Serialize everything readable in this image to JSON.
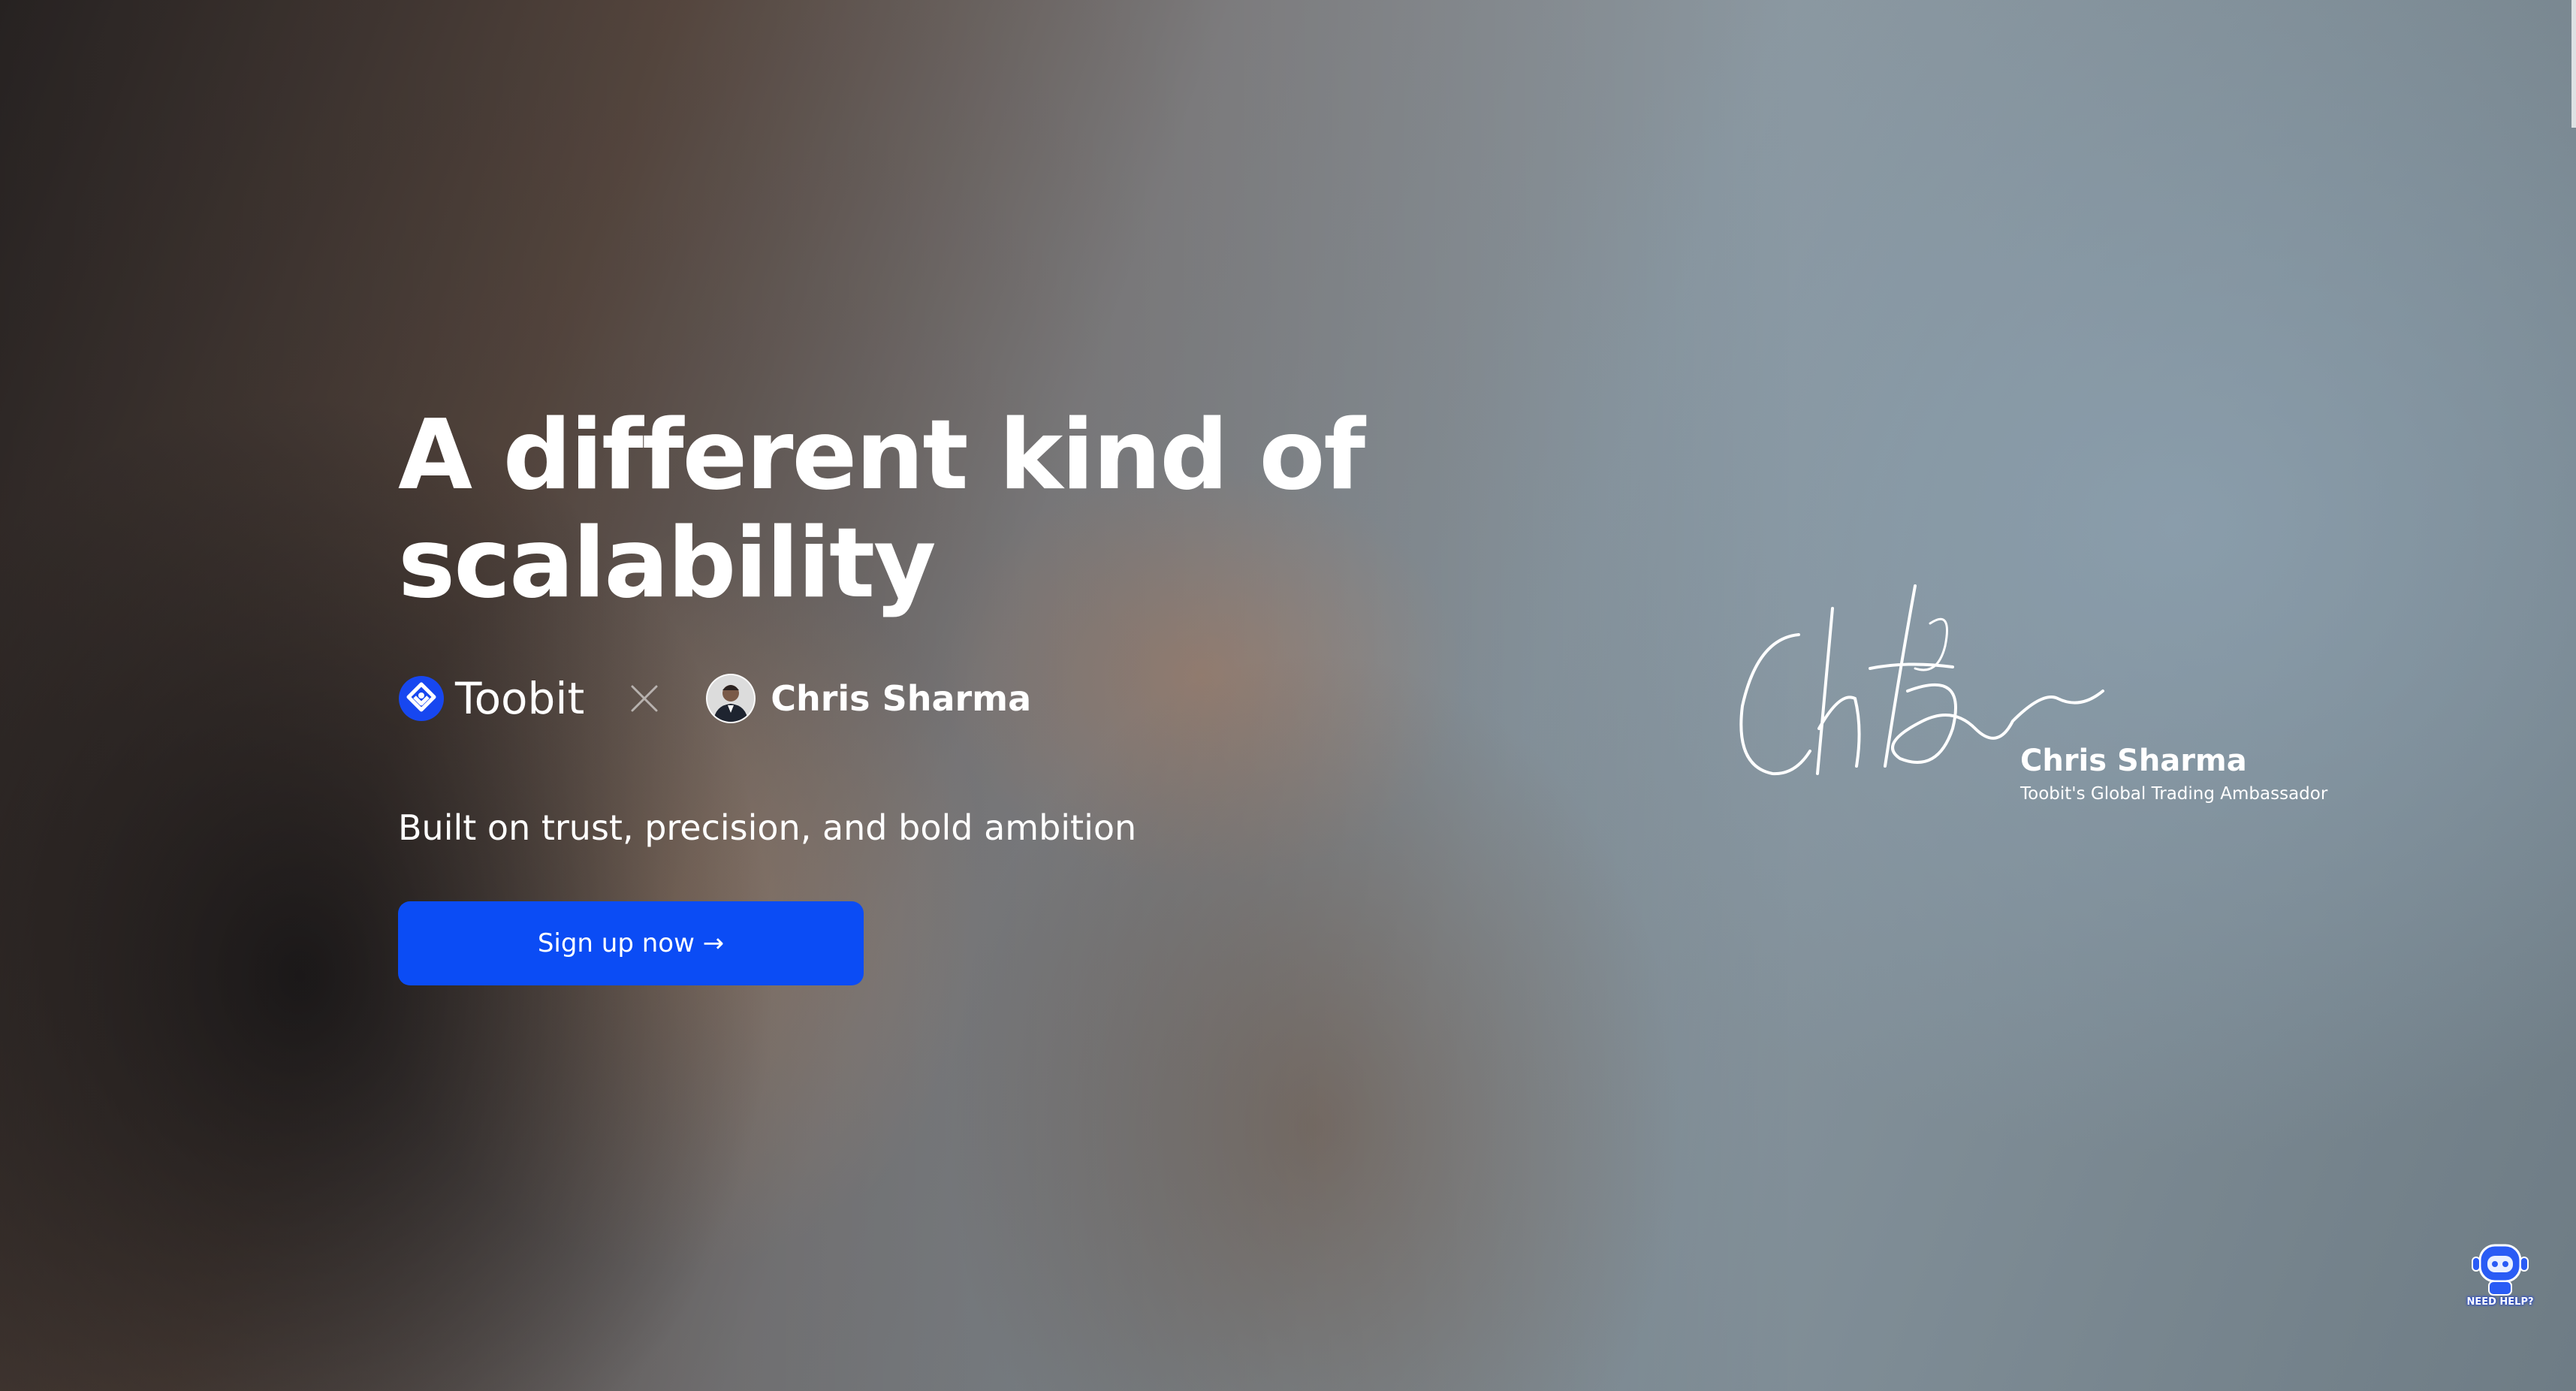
{
  "hero": {
    "headline_line1": "A different kind of",
    "headline_line2": "scalability",
    "brand_name": "Toobit",
    "partner_name": "Chris Sharma",
    "subtitle": "Built on trust, precision, and bold ambition",
    "cta_label": "Sign up now →"
  },
  "signature": {
    "name": "Chris Sharma",
    "title": "Toobit's Global Trading Ambassador"
  },
  "help_widget": {
    "label": "NEED HELP?"
  },
  "colors": {
    "cta": "#0b4cf5",
    "brand_logo": "#1747f0",
    "text": "#ffffff"
  },
  "icons": [
    "toobit-logo-icon",
    "collab-x-icon",
    "avatar",
    "signature",
    "help-bot-icon"
  ]
}
